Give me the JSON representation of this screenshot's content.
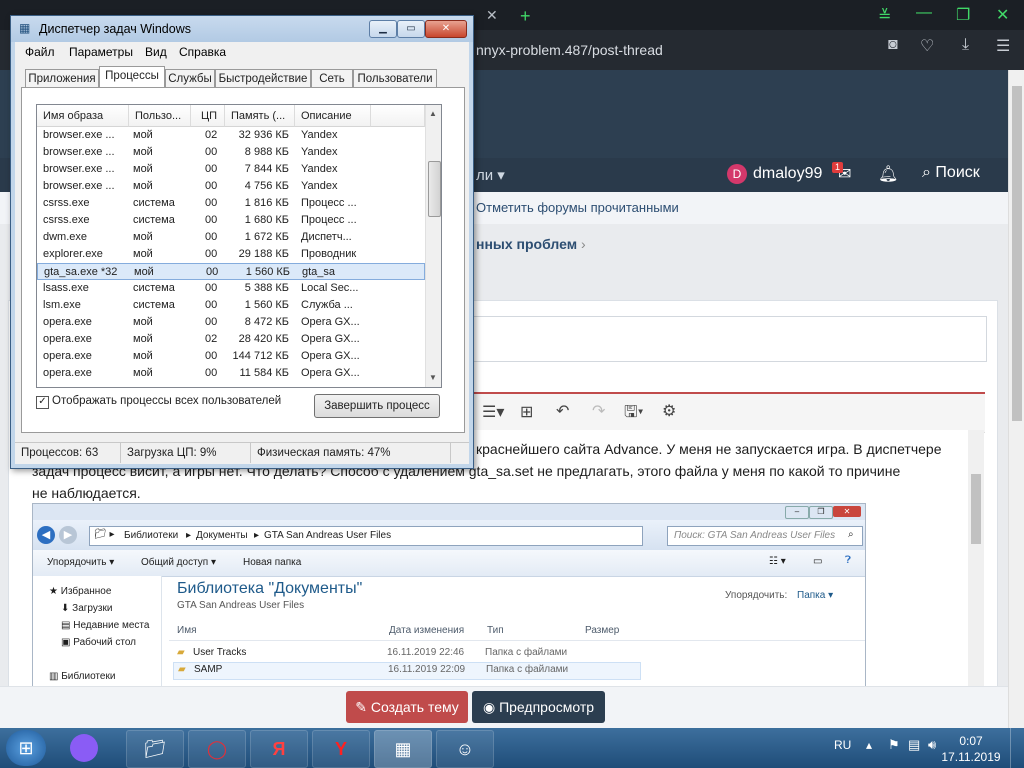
{
  "browser": {
    "url_fragment": "nnyx-problem.487/post-thread"
  },
  "forum": {
    "nav_fragment": "ли",
    "user": {
      "avatar_letter": "D",
      "name": "dmaloy99",
      "badge": "1"
    },
    "search_label": "Поиск",
    "mark_read": "Отметить форумы прочитанными",
    "breadcrumb_fragment": "нных проблем",
    "post_text_line1": "краснейшего сайта Advance. У меня не запускается игра. В диспетчере",
    "post_text_line2": "задач процесс висит, а игры нет. Что делать? Способ с удалением gta_sa.set  не предлагать, этого файла у меня по какой то причине",
    "post_text_line3": "не наблюдается.",
    "create_thread": "Создать тему",
    "preview": "Предпросмотр"
  },
  "explorer": {
    "path": [
      "Библиотеки",
      "Документы",
      "GTA San Andreas User Files"
    ],
    "search_placeholder": "Поиск: GTA San Andreas User Files",
    "tools": [
      "Упорядочить",
      "Общий доступ",
      "Новая папка"
    ],
    "sidebar": [
      "Избранное",
      "Загрузки",
      "Недавние места",
      "Рабочий стол",
      "Библиотеки"
    ],
    "library_title": "Библиотека \"Документы\"",
    "library_sub": "GTA San Andreas User Files",
    "arrange_label": "Упорядочить:",
    "arrange_value": "Папка",
    "columns": [
      "Имя",
      "Дата изменения",
      "Тип",
      "Размер"
    ],
    "files": [
      {
        "name": "User Tracks",
        "date": "16.11.2019 22:46",
        "type": "Папка с файлами"
      },
      {
        "name": "SAMP",
        "date": "16.11.2019 22:09",
        "type": "Папка с файлами"
      }
    ]
  },
  "taskmgr": {
    "title": "Диспетчер задач Windows",
    "menu": [
      "Файл",
      "Параметры",
      "Вид",
      "Справка"
    ],
    "tabs": [
      "Приложения",
      "Процессы",
      "Службы",
      "Быстродействие",
      "Сеть",
      "Пользователи"
    ],
    "columns": [
      "Имя образа",
      "Пользо...",
      "ЦП",
      "Память (...",
      "Описание"
    ],
    "rows": [
      [
        "browser.exe ...",
        "мой",
        "02",
        "32 936 КБ",
        "Yandex"
      ],
      [
        "browser.exe ...",
        "мой",
        "00",
        "8 988 КБ",
        "Yandex"
      ],
      [
        "browser.exe ...",
        "мой",
        "00",
        "7 844 КБ",
        "Yandex"
      ],
      [
        "browser.exe ...",
        "мой",
        "00",
        "4 756 КБ",
        "Yandex"
      ],
      [
        "csrss.exe",
        "система",
        "00",
        "1 816 КБ",
        "Процесс ..."
      ],
      [
        "csrss.exe",
        "система",
        "00",
        "1 680 КБ",
        "Процесс ..."
      ],
      [
        "dwm.exe",
        "мой",
        "00",
        "1 672 КБ",
        "Диспетч..."
      ],
      [
        "explorer.exe",
        "мой",
        "00",
        "29 188 КБ",
        "Проводник"
      ],
      [
        "gta_sa.exe *32",
        "мой",
        "00",
        "1 560 КБ",
        "gta_sa"
      ],
      [
        "lsass.exe",
        "система",
        "00",
        "5 388 КБ",
        "Local Sec..."
      ],
      [
        "lsm.exe",
        "система",
        "00",
        "1 560 КБ",
        "Служба ..."
      ],
      [
        "opera.exe",
        "мой",
        "00",
        "8 472 КБ",
        "Opera GX..."
      ],
      [
        "opera.exe",
        "мой",
        "02",
        "28 420 КБ",
        "Opera GX..."
      ],
      [
        "opera.exe",
        "мой",
        "00",
        "144 712 КБ",
        "Opera GX..."
      ],
      [
        "opera.exe",
        "мой",
        "00",
        "11 584 КБ",
        "Opera GX..."
      ]
    ],
    "selected_row": "gta_sa.exe *32",
    "show_all_label": "Отображать процессы всех пользователей",
    "end_process": "Завершить процесс",
    "status": {
      "processes": "Процессов: 63",
      "cpu": "Загрузка ЦП: 9%",
      "memory": "Физическая память: 47%"
    }
  },
  "taskbar": {
    "lang": "RU",
    "time": "0:07",
    "date": "17.11.2019"
  }
}
